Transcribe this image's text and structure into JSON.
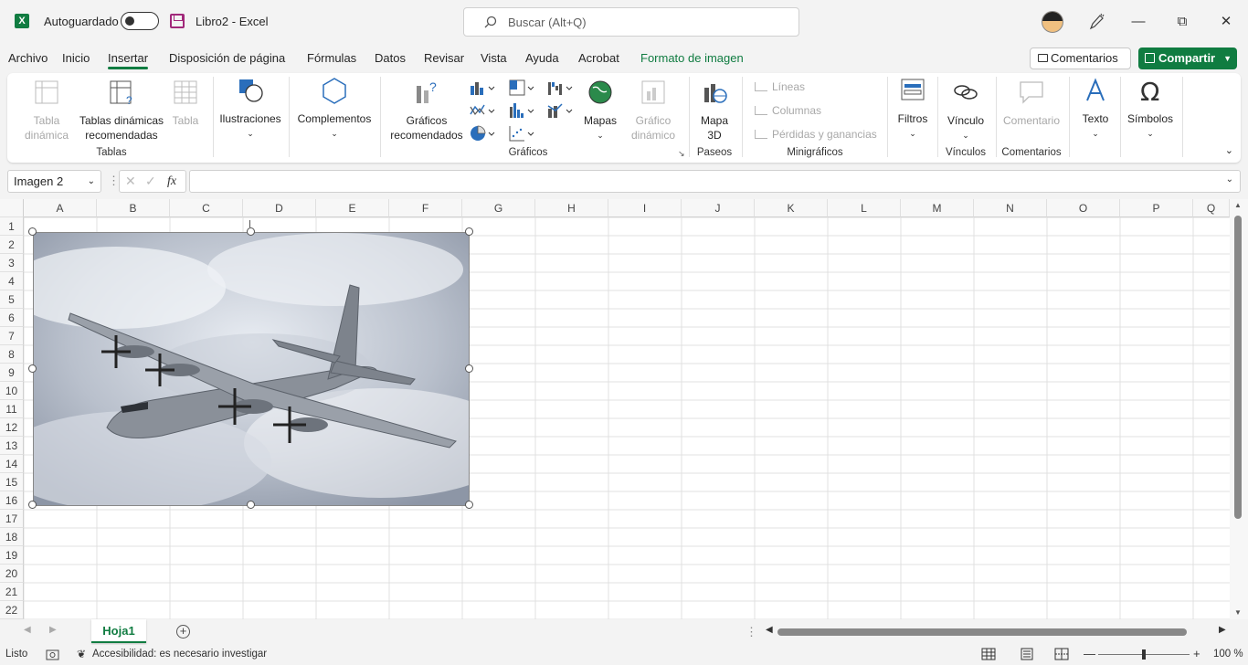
{
  "app": {
    "logo_letter": "X",
    "autosave_label": "Autoguardado",
    "title": "Libro2  -  Excel",
    "search_placeholder": "Buscar (Alt+Q)"
  },
  "menu": {
    "items": [
      "Archivo",
      "Inicio",
      "Insertar",
      "Disposición de página",
      "Fórmulas",
      "Datos",
      "Revisar",
      "Vista",
      "Ayuda",
      "Acrobat",
      "Formato de imagen"
    ],
    "active": "Insertar",
    "comments_label": "Comentarios",
    "share_label": "Compartir"
  },
  "ribbon": {
    "tabla_dinamica": "Tabla dinámica",
    "tablas_dinamicas_rec": "Tablas dinámicas recomendadas",
    "tabla": "Tabla",
    "grp_tablas": "Tablas",
    "ilustraciones": "Ilustraciones",
    "complementos": "Complementos",
    "graficos_rec": "Gráficos recomendados",
    "mapas": "Mapas",
    "grafico_dinamico": "Gráfico dinámico",
    "grp_graficos": "Gráficos",
    "mapa_3d": "Mapa 3D",
    "grp_paseos": "Paseos",
    "lineas": "Líneas",
    "columnas": "Columnas",
    "perdidas": "Pérdidas y ganancias",
    "grp_minigraficos": "Minigráficos",
    "filtros": "Filtros",
    "vinculo": "Vínculo",
    "grp_vinculos": "Vínculos",
    "comentario": "Comentario",
    "grp_comentarios": "Comentarios",
    "texto": "Texto",
    "simbolos": "Símbolos"
  },
  "formula_bar": {
    "name_box": "Imagen 2",
    "fx_label": "fx",
    "formula": ""
  },
  "grid": {
    "columns": [
      "A",
      "B",
      "C",
      "D",
      "E",
      "F",
      "G",
      "H",
      "I",
      "J",
      "K",
      "L",
      "M",
      "N",
      "O",
      "P",
      "Q"
    ],
    "rows": [
      "1",
      "2",
      "3",
      "4",
      "5",
      "6",
      "7",
      "8",
      "9",
      "10",
      "11",
      "12",
      "13",
      "14",
      "15",
      "16",
      "17",
      "18",
      "19",
      "20",
      "21",
      "22"
    ]
  },
  "sheets": {
    "tabs": [
      "Hoja1"
    ]
  },
  "status": {
    "ready": "Listo",
    "accessibility": "Accesibilidad: es necesario investigar",
    "zoom": "100 %"
  },
  "colors": {
    "accent": "#107c41",
    "ribbon_bg": "#ffffff",
    "window_bg": "#f3f3f3"
  }
}
